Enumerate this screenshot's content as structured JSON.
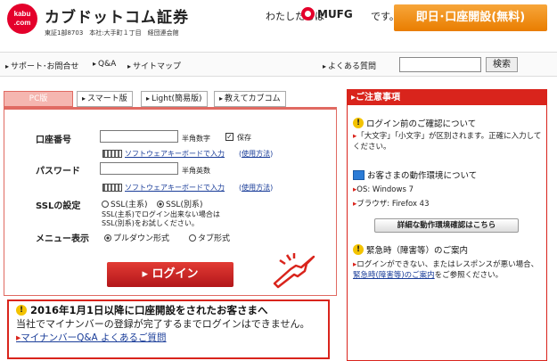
{
  "header": {
    "logo_line1": "kabu",
    "logo_line2": ".com",
    "brand": "カブドットコム証券",
    "address": "東証1部8703　本社:大手町１丁目　経団連会館",
    "tagline": "わたしたちは",
    "mufg": "MUFG",
    "mufg_suffix": "です。",
    "open_account": "即日･口座開設(無料)"
  },
  "nav": {
    "support": "サポート･お問合せ",
    "qa": "Q&A",
    "sitemap": "サイトマップ",
    "faq": "よくある質問",
    "search_btn": "検索"
  },
  "tabs": [
    {
      "label": "PC版"
    },
    {
      "label": "スマート版"
    },
    {
      "label": "Light(簡易版)"
    },
    {
      "label": "教えてカブコム"
    }
  ],
  "login": {
    "account_label": "口座番号",
    "account_hint": "半角数字",
    "save_label": "保存",
    "keyboard_link": "ソフトウェアキーボードで入力",
    "usage_link": "使用方法",
    "password_label": "パスワード",
    "password_hint": "半角英数",
    "ssl_label": "SSLの設定",
    "ssl_main": "SSL(主系)",
    "ssl_alt": "SSL(別系)",
    "ssl_note1": "SSL(主系)でログイン出来ない場合は",
    "ssl_note2": "SSL(別系)をお試しください。",
    "menu_label": "メニュー表示",
    "menu_pulldown": "プルダウン形式",
    "menu_tab": "タブ形式",
    "login_btn": "ログイン"
  },
  "notice": {
    "title": "2016年1月1日以降に口座開設をされたお客さまへ",
    "body": "当社でマイナンバーの登録が完了するまでログインはできません。",
    "link": "マイナンバーQ&A よくあるご質問"
  },
  "caution": {
    "head": "ご注意事項",
    "s1_title": "ログイン前のご確認について",
    "s1_text": "「大文字」「小文字」が区別されます。正確に入力してください。",
    "s2_title": "お客さまの動作環境について",
    "s2_os": "OS: Windows 7",
    "s2_browser": "ブラウザ: Firefox 43",
    "env_btn": "詳細な動作環境確認はこちら",
    "s3_title": "緊急時（障害等）のご案内",
    "s3_text1": "ログインができない、またはレスポンスが悪い場合、",
    "s3_link": "緊急時(障害等)のご案内",
    "s3_text2": "をご参照ください。"
  },
  "colors": {
    "brand_red": "#d9241c",
    "orange": "#e97d00",
    "link": "#1a3d99"
  }
}
